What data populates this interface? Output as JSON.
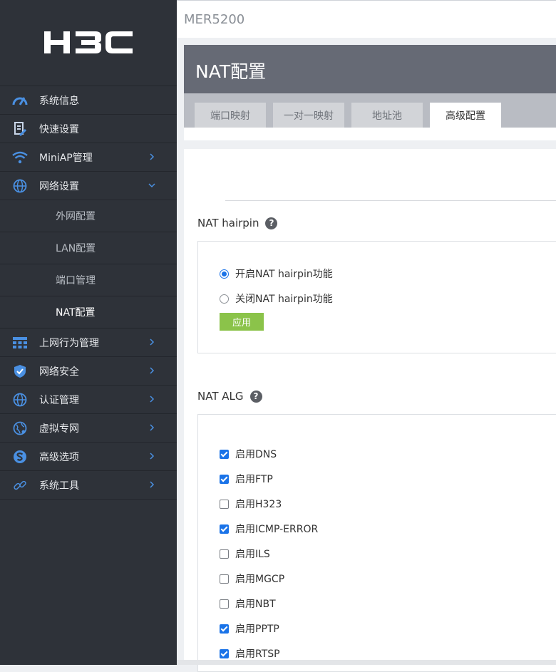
{
  "brand": {
    "logo_text": "H3C"
  },
  "sidebar": {
    "items": [
      {
        "label": "系统信息",
        "icon": "dashboard-gauge-icon"
      },
      {
        "label": "快速设置",
        "icon": "quick-setup-icon"
      },
      {
        "label": "MiniAP管理",
        "icon": "wifi-icon",
        "expandable": true
      },
      {
        "label": "网络设置",
        "icon": "globe-icon",
        "expandable": true,
        "expanded": true
      },
      {
        "label": "上网行为管理",
        "icon": "behavior-grid-icon",
        "expandable": true
      },
      {
        "label": "网络安全",
        "icon": "shield-icon",
        "expandable": true
      },
      {
        "label": "认证管理",
        "icon": "globe-auth-icon",
        "expandable": true
      },
      {
        "label": "虚拟专网",
        "icon": "vpn-globe-icon",
        "expandable": true
      },
      {
        "label": "高级选项",
        "icon": "advanced-s-icon",
        "expandable": true
      },
      {
        "label": "系统工具",
        "icon": "tools-link-icon",
        "expandable": true
      }
    ],
    "subitems": [
      {
        "label": "外网配置"
      },
      {
        "label": "LAN配置"
      },
      {
        "label": "端口管理"
      },
      {
        "label": "NAT配置",
        "active": true
      }
    ]
  },
  "topbar": {
    "device_name": "MER5200"
  },
  "header": {
    "title": "NAT配置",
    "tabs": [
      {
        "label": "端口映射"
      },
      {
        "label": "一对一映射"
      },
      {
        "label": "地址池"
      },
      {
        "label": "高级配置",
        "active": true
      }
    ]
  },
  "hairpin": {
    "title": "NAT hairpin",
    "help": "?",
    "options": [
      {
        "label": "开启NAT hairpin功能",
        "checked": true
      },
      {
        "label": "关闭NAT hairpin功能",
        "checked": false
      }
    ],
    "apply_label": "应用"
  },
  "alg": {
    "title": "NAT ALG",
    "help": "?",
    "items": [
      {
        "label": "启用DNS",
        "checked": true
      },
      {
        "label": "启用FTP",
        "checked": true
      },
      {
        "label": "启用H323",
        "checked": false
      },
      {
        "label": "启用ICMP-ERROR",
        "checked": true
      },
      {
        "label": "启用ILS",
        "checked": false
      },
      {
        "label": "启用MGCP",
        "checked": false
      },
      {
        "label": "启用NBT",
        "checked": false
      },
      {
        "label": "启用PPTP",
        "checked": true
      },
      {
        "label": "启用RTSP",
        "checked": true
      }
    ]
  },
  "colors": {
    "sidebar_bg": "#2e3239",
    "accent_blue": "#1a73e8",
    "apply_green": "#8bc34a",
    "header_bg": "#666a75"
  }
}
